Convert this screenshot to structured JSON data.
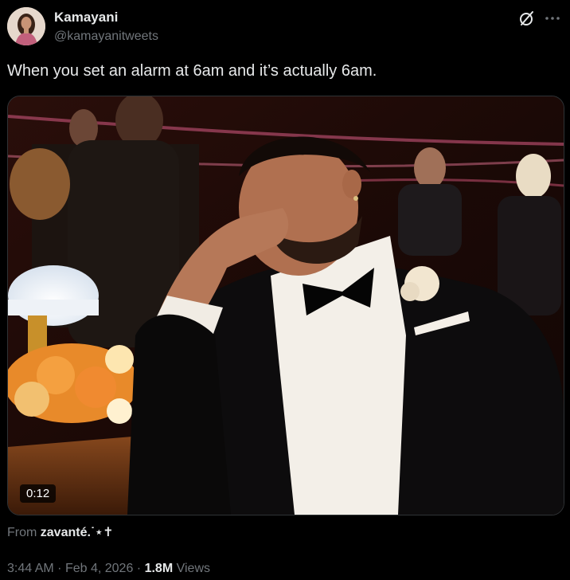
{
  "author": {
    "display_name": "Kamayani",
    "handle": "@kamayanitweets",
    "avatar_icon": "profile-photo"
  },
  "header_icons": {
    "grok": "grok-slash-circle-icon",
    "more": "more-dots-icon"
  },
  "tweet": {
    "text": "When you set an alarm at 6am and it’s actually 6am."
  },
  "media": {
    "type": "video",
    "duration": "0:12",
    "description_icon": "video-thumbnail"
  },
  "source": {
    "prefix": "From",
    "name": "zavanté.˙⋆✝"
  },
  "meta": {
    "time": "3:44 AM",
    "separator": "·",
    "date": "Feb 4, 2026",
    "views_count": "1.8M",
    "views_label": "Views"
  },
  "colors": {
    "background": "#000000",
    "text_primary": "#e7e9ea",
    "text_secondary": "#71767b",
    "border": "#2f3336"
  }
}
